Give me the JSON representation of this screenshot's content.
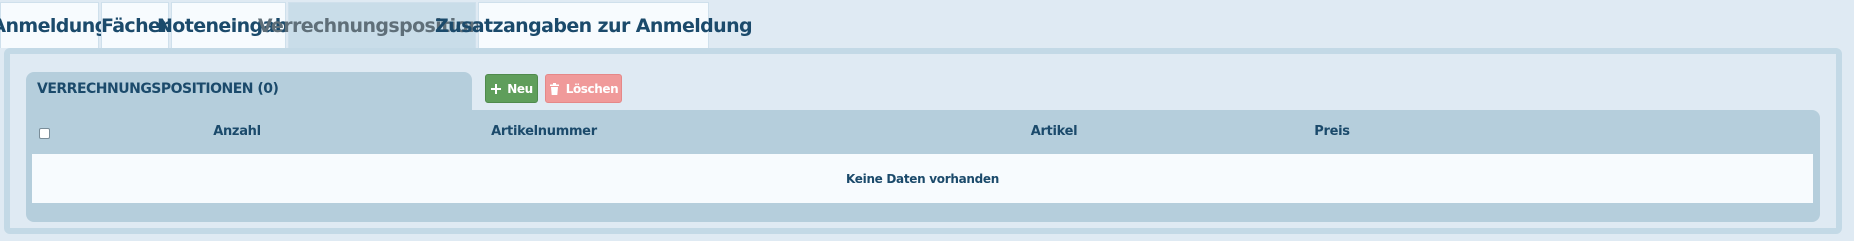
{
  "tabs": [
    {
      "label": "Anmeldung",
      "active": false
    },
    {
      "label": "Fächer",
      "active": false
    },
    {
      "label": "Noteneingabe",
      "active": false
    },
    {
      "label": "Verrechnungspositionen",
      "active": true
    },
    {
      "label": "Zusatzangaben zur Anmeldung",
      "active": false
    }
  ],
  "panel": {
    "title": "VERRECHNUNGSPOSITIONEN (0)",
    "buttons": {
      "new_label": "Neu",
      "new_icon": "plus-icon",
      "delete_label": "Löschen",
      "delete_icon": "trash-icon"
    },
    "table": {
      "columns": [
        "Anzahl",
        "Artikelnummer",
        "Artikel",
        "Preis"
      ],
      "empty_text": "Keine Daten vorhanden",
      "select_all_checked": false
    }
  },
  "colors": {
    "background": "#dfeaf3",
    "frame_border": "#c3d9e6",
    "panel": "#b5cedc",
    "text_primary": "#1b4a6b",
    "button_new": "#5f9e5b",
    "button_delete": "#f09a9a",
    "active_tab": "#c9dde9"
  }
}
